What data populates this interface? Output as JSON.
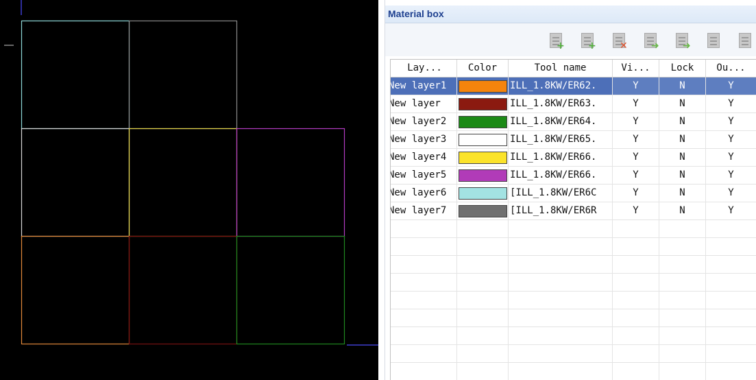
{
  "panel": {
    "title": "Material box",
    "toolbar": [
      {
        "name": "add-layer-button",
        "mark": "+",
        "kind": "plus"
      },
      {
        "name": "insert-layer-button",
        "mark": "+",
        "kind": "plus"
      },
      {
        "name": "delete-layer-button",
        "mark": "✕",
        "kind": "x"
      },
      {
        "name": "move-up-button",
        "mark": "➜",
        "kind": "arrow"
      },
      {
        "name": "move-down-button",
        "mark": "➜",
        "kind": "arrow"
      },
      {
        "name": "properties-button",
        "mark": "",
        "kind": ""
      },
      {
        "name": "refresh-button",
        "mark": "",
        "kind": ""
      }
    ]
  },
  "table": {
    "headers": [
      "Lay...",
      "Color",
      "Tool name",
      "Vi...",
      "Lock",
      "Ou..."
    ],
    "rows": [
      {
        "layer": "New layer1",
        "color": "#f5840c",
        "tool": "ILL_1.8KW/ER62.",
        "visible": "Y",
        "lock": "N",
        "output": "Y",
        "selected": true
      },
      {
        "layer": "New layer",
        "color": "#8b1a10",
        "tool": "ILL_1.8KW/ER63.",
        "visible": "Y",
        "lock": "N",
        "output": "Y",
        "selected": false
      },
      {
        "layer": "New layer2",
        "color": "#1c8a16",
        "tool": "ILL_1.8KW/ER64.",
        "visible": "Y",
        "lock": "N",
        "output": "Y",
        "selected": false
      },
      {
        "layer": "New layer3",
        "color": "#ffffff",
        "tool": "ILL_1.8KW/ER65.",
        "visible": "Y",
        "lock": "N",
        "output": "Y",
        "selected": false
      },
      {
        "layer": "New layer4",
        "color": "#fbe32a",
        "tool": "ILL_1.8KW/ER66.",
        "visible": "Y",
        "lock": "N",
        "output": "Y",
        "selected": false
      },
      {
        "layer": "New layer5",
        "color": "#b13bb8",
        "tool": "ILL_1.8KW/ER66.",
        "visible": "Y",
        "lock": "N",
        "output": "Y",
        "selected": false
      },
      {
        "layer": "New layer6",
        "color": "#a3e3e3",
        "tool": "[ILL_1.8KW/ER6C",
        "visible": "Y",
        "lock": "N",
        "output": "Y",
        "selected": false
      },
      {
        "layer": "New layer7",
        "color": "#707070",
        "tool": "[ILL_1.8KW/ER6R",
        "visible": "Y",
        "lock": "N",
        "output": "Y",
        "selected": false
      }
    ],
    "empty_rows": 9
  },
  "canvas": {
    "background": "#000000",
    "grid": [
      [
        "#8fd9d9",
        "#8a8a8a",
        null
      ],
      [
        "#d8d8d8",
        "#e7d64a",
        "#b43cc4"
      ],
      [
        "#e48a3a",
        "#7a1010",
        "#1f8a1f"
      ]
    ],
    "axis_color": "#2e2e9a"
  }
}
